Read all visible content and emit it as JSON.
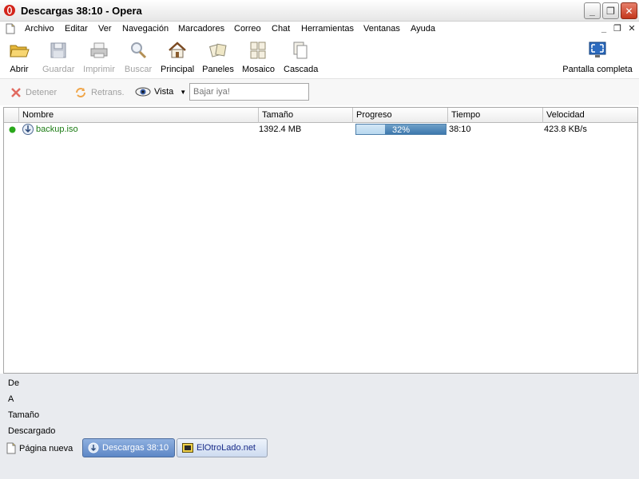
{
  "window": {
    "title": "Descargas 38:10 - Opera"
  },
  "menu": {
    "items": [
      "Archivo",
      "Editar",
      "Ver",
      "Navegación",
      "Marcadores",
      "Correo",
      "Chat",
      "Herramientas",
      "Ventanas",
      "Ayuda"
    ]
  },
  "toolbar": {
    "open": "Abrir",
    "save": "Guardar",
    "print": "Imprimir",
    "find": "Buscar",
    "home": "Principal",
    "panels": "Paneles",
    "tile": "Mosaico",
    "cascade": "Cascada",
    "fullscreen": "Pantalla completa"
  },
  "transfers": {
    "stop": "Detener",
    "retry": "Retrans.",
    "view": "Vista",
    "search_placeholder": "Bajar iya!"
  },
  "table": {
    "columns": [
      "Nombre",
      "Tamaño",
      "Progreso",
      "Tiempo",
      "Velocidad"
    ],
    "rows": [
      {
        "name": "backup.iso",
        "size": "1392.4 MB",
        "progress_label": "32%",
        "progress_value": 0.32,
        "time": "38:10",
        "speed": "423.8 KB/s",
        "status_color": "#2aa81b"
      }
    ]
  },
  "details": {
    "from": "De",
    "to": "A",
    "size": "Tamaño",
    "downloaded": "Descargado"
  },
  "pagebar": {
    "new_page": "Página nueva",
    "tabs": [
      "Descargas 38:10",
      "ElOtroLado.net"
    ]
  },
  "colors": {
    "link_green": "#1c7c14",
    "accent_blue": "#3d78ad"
  }
}
